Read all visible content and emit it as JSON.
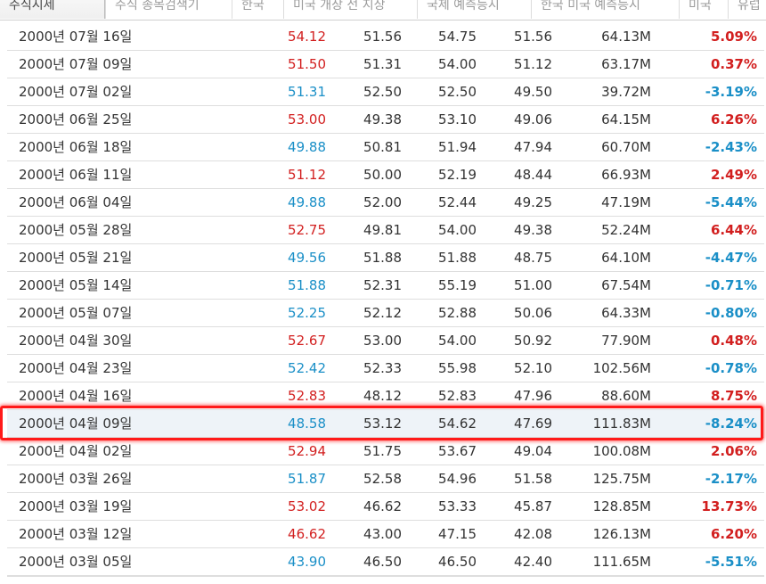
{
  "tabs": [
    {
      "label": "주식시세"
    },
    {
      "label": "주식 종목검색기"
    },
    {
      "label": "한국"
    },
    {
      "label": "미국 개장 전 지상"
    },
    {
      "label": "국제 예측등시"
    },
    {
      "label": "한국 미국 예측등시"
    },
    {
      "label": "미국"
    },
    {
      "label": "유럽"
    }
  ],
  "rows": [
    {
      "date": "2000년 07월 16일",
      "close": "54.12",
      "open": "51.56",
      "high": "54.75",
      "low": "51.56",
      "volume": "64.13M",
      "change": "5.09%",
      "dir": "up"
    },
    {
      "date": "2000년 07월 09일",
      "close": "51.50",
      "open": "51.31",
      "high": "54.00",
      "low": "51.12",
      "volume": "63.17M",
      "change": "0.37%",
      "dir": "up"
    },
    {
      "date": "2000년 07월 02일",
      "close": "51.31",
      "open": "52.50",
      "high": "52.50",
      "low": "49.50",
      "volume": "39.72M",
      "change": "-3.19%",
      "dir": "down"
    },
    {
      "date": "2000년 06월 25일",
      "close": "53.00",
      "open": "49.38",
      "high": "53.10",
      "low": "49.06",
      "volume": "64.15M",
      "change": "6.26%",
      "dir": "up"
    },
    {
      "date": "2000년 06월 18일",
      "close": "49.88",
      "open": "50.81",
      "high": "51.94",
      "low": "47.94",
      "volume": "60.70M",
      "change": "-2.43%",
      "dir": "down"
    },
    {
      "date": "2000년 06월 11일",
      "close": "51.12",
      "open": "50.00",
      "high": "52.19",
      "low": "48.44",
      "volume": "66.93M",
      "change": "2.49%",
      "dir": "up"
    },
    {
      "date": "2000년 06월 04일",
      "close": "49.88",
      "open": "52.00",
      "high": "52.44",
      "low": "49.25",
      "volume": "47.19M",
      "change": "-5.44%",
      "dir": "down"
    },
    {
      "date": "2000년 05월 28일",
      "close": "52.75",
      "open": "49.81",
      "high": "54.00",
      "low": "49.38",
      "volume": "52.24M",
      "change": "6.44%",
      "dir": "up"
    },
    {
      "date": "2000년 05월 21일",
      "close": "49.56",
      "open": "51.88",
      "high": "51.88",
      "low": "48.75",
      "volume": "64.10M",
      "change": "-4.47%",
      "dir": "down"
    },
    {
      "date": "2000년 05월 14일",
      "close": "51.88",
      "open": "52.31",
      "high": "55.19",
      "low": "51.00",
      "volume": "67.54M",
      "change": "-0.71%",
      "dir": "down"
    },
    {
      "date": "2000년 05월 07일",
      "close": "52.25",
      "open": "52.12",
      "high": "52.88",
      "low": "50.06",
      "volume": "64.33M",
      "change": "-0.80%",
      "dir": "down"
    },
    {
      "date": "2000년 04월 30일",
      "close": "52.67",
      "open": "53.00",
      "high": "54.00",
      "low": "50.92",
      "volume": "77.90M",
      "change": "0.48%",
      "dir": "up"
    },
    {
      "date": "2000년 04월 23일",
      "close": "52.42",
      "open": "52.33",
      "high": "55.98",
      "low": "52.10",
      "volume": "102.56M",
      "change": "-0.78%",
      "dir": "down"
    },
    {
      "date": "2000년 04월 16일",
      "close": "52.83",
      "open": "48.12",
      "high": "52.83",
      "low": "47.96",
      "volume": "88.60M",
      "change": "8.75%",
      "dir": "up"
    },
    {
      "date": "2000년 04월 09일",
      "close": "48.58",
      "open": "53.12",
      "high": "54.62",
      "low": "47.69",
      "volume": "111.83M",
      "change": "-8.24%",
      "dir": "down",
      "highlight": true
    },
    {
      "date": "2000년 04월 02일",
      "close": "52.94",
      "open": "51.75",
      "high": "53.67",
      "low": "49.04",
      "volume": "100.08M",
      "change": "2.06%",
      "dir": "up"
    },
    {
      "date": "2000년 03월 26일",
      "close": "51.87",
      "open": "52.58",
      "high": "54.96",
      "low": "51.58",
      "volume": "125.75M",
      "change": "-2.17%",
      "dir": "down"
    },
    {
      "date": "2000년 03월 19일",
      "close": "53.02",
      "open": "46.62",
      "high": "53.33",
      "low": "45.87",
      "volume": "128.85M",
      "change": "13.73%",
      "dir": "up"
    },
    {
      "date": "2000년 03월 12일",
      "close": "46.62",
      "open": "43.00",
      "high": "47.15",
      "low": "42.08",
      "volume": "126.13M",
      "change": "6.20%",
      "dir": "up"
    },
    {
      "date": "2000년 03월 05일",
      "close": "43.90",
      "open": "46.50",
      "high": "46.50",
      "low": "42.40",
      "volume": "111.65M",
      "change": "-5.51%",
      "dir": "down"
    }
  ],
  "colors": {
    "up": "#d21f1f",
    "down": "#1a8fc7",
    "highlight_border": "#ff1a1a"
  }
}
